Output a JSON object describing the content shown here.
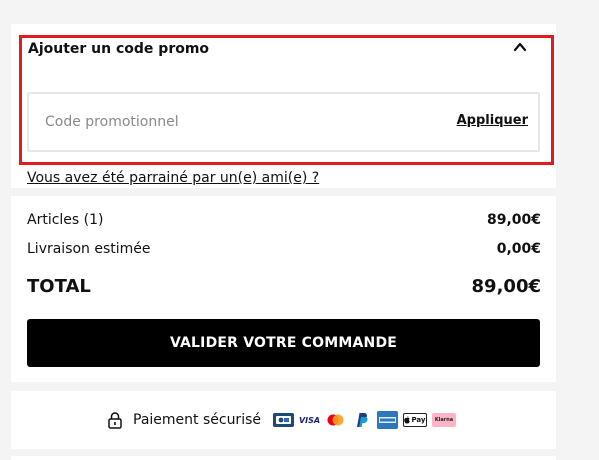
{
  "promo": {
    "title": "Ajouter un code promo",
    "placeholder": "Code promotionnel",
    "apply_label": "Appliquer",
    "referral_link": "Vous avez été parrainé par un(e) ami(e) ?",
    "toggle_icon": "chevron-up-icon",
    "highlight_color": "#e21c1c"
  },
  "summary": {
    "articles_label": "Articles (1)",
    "articles_value": "89,00€",
    "shipping_label": "Livraison estimée",
    "shipping_value": "0,00€",
    "total_label": "TOTAL",
    "total_value": "89,00€"
  },
  "checkout": {
    "button_label": "VALIDER VOTRE COMMANDE",
    "button_color": "#000000"
  },
  "secure": {
    "label": "Paiement sécurisé",
    "icon": "lock-icon",
    "methods": [
      {
        "name": "carte-bancaire-icon"
      },
      {
        "name": "visa-icon",
        "text": "VISA"
      },
      {
        "name": "mastercard-icon"
      },
      {
        "name": "paypal-icon"
      },
      {
        "name": "amex-icon"
      },
      {
        "name": "apple-pay-icon",
        "text": "Pay"
      },
      {
        "name": "klarna-icon",
        "text": "Klarna"
      }
    ]
  }
}
